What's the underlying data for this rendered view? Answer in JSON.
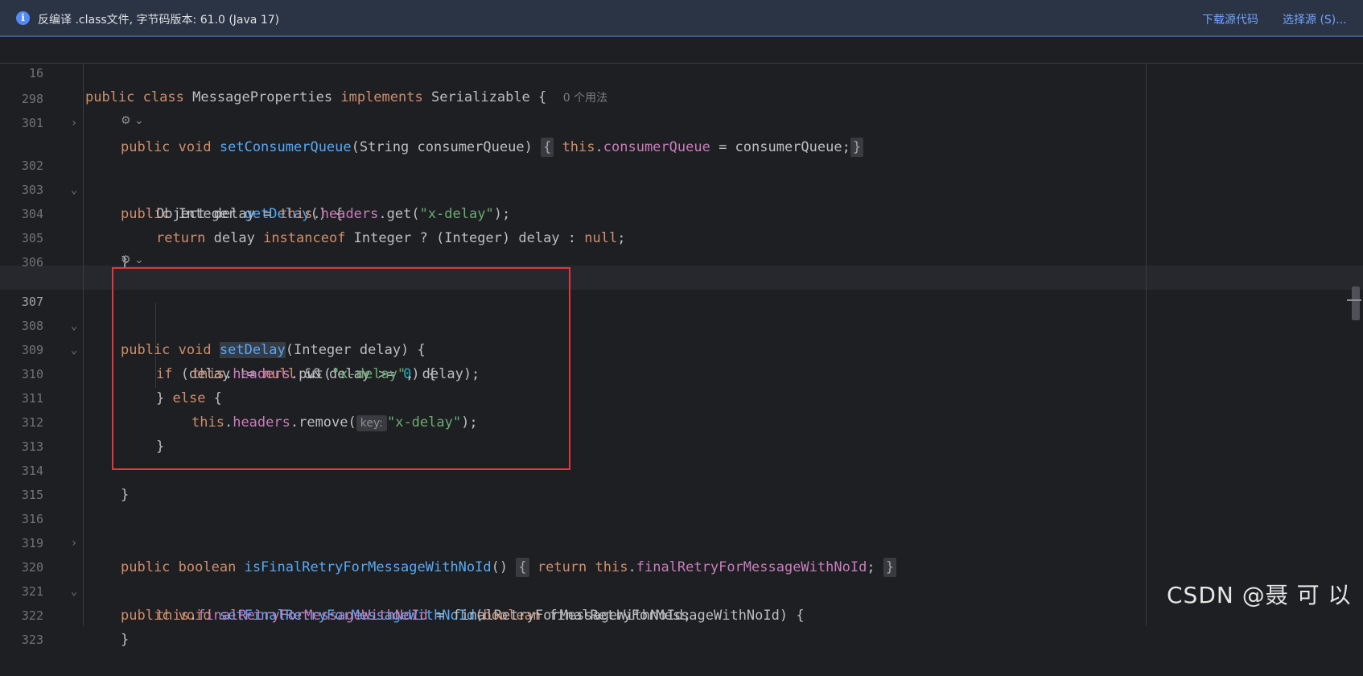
{
  "banner": {
    "message": "反编译 .class文件, 字节码版本: 61.0 (Java 17)",
    "download_link": "下载源代码",
    "choose_source_link": "选择源 (S)..."
  },
  "sticky": {
    "line_number": "16",
    "code_kw1": "public",
    "code_kw2": "class",
    "code_name": "MessageProperties",
    "code_kw3": "implements",
    "code_iface": "Serializable",
    "code_brace": "{",
    "usage_hint": "0 个用法"
  },
  "lines": {
    "l298": {
      "num": "298",
      "kw1": "public",
      "kw2": "void",
      "fn": "setConsumerQueue",
      "params": "(String consumerQueue)",
      "fold_open": "{",
      "this": "this",
      "dot": ".",
      "field": "consumerQueue",
      "rest": " = consumerQueue;",
      "fold_close": "}"
    },
    "l301": {
      "num": "301"
    },
    "l302": {
      "num": "302",
      "kw1": "public",
      "type": "Integer",
      "fn": "getDelay",
      "rest": "() {"
    },
    "l303": {
      "num": "303",
      "pre": "Object delay = ",
      "this": "this",
      "dot": ".",
      "field": "headers",
      "mid": ".get(",
      "str": "\"x-delay\"",
      "post": ");"
    },
    "l304": {
      "num": "304",
      "kw1": "return",
      "mid1": " delay ",
      "kw2": "instanceof",
      "mid2": " Integer ? (Integer) delay : ",
      "kw3": "null",
      "post": ";"
    },
    "l305": {
      "num": "305",
      "text": "}"
    },
    "l306": {
      "num": "306"
    },
    "l307": {
      "num": "307",
      "kw1": "public",
      "kw2": "void",
      "fn": "setDelay",
      "rest": "(Integer delay) {"
    },
    "l308": {
      "num": "308",
      "kw1": "if",
      "mid1": " (delay != ",
      "kw2": "null",
      "mid2": " && delay >= ",
      "num_lit": "0",
      "post": ") {"
    },
    "l309": {
      "num": "309",
      "this": "this",
      "dot": ".",
      "field": "headers",
      "mid": ".put(",
      "str": "\"x-delay\"",
      "post": ", delay);"
    },
    "l310": {
      "num": "310",
      "pre": "} ",
      "kw1": "else",
      "post": " {"
    },
    "l311": {
      "num": "311",
      "this": "this",
      "dot": ".",
      "field": "headers",
      "mid": ".remove(",
      "hint": "key:",
      "str": "\"x-delay\"",
      "post": ");"
    },
    "l312": {
      "num": "312",
      "text": "}"
    },
    "l313": {
      "num": "313"
    },
    "l314": {
      "num": "314",
      "text": "}"
    },
    "l315": {
      "num": "315"
    },
    "l316": {
      "num": "316",
      "kw1": "public",
      "kw2": "boolean",
      "fn": "isFinalRetryForMessageWithNoId",
      "params": "()",
      "fold_open": "{",
      "kw3": "return",
      "this": "this",
      "dot": ".",
      "field": "finalRetryForMessageWithNoId",
      "post": ";",
      "fold_close": "}"
    },
    "l319": {
      "num": "319"
    },
    "l320": {
      "num": "320",
      "kw1": "public",
      "kw2": "void",
      "fn": "setFinalRetryForMessageWithNoId",
      "p_open": "(",
      "kw3": "boolean",
      "rest": " finalRetryForMessageWithNoId) {"
    },
    "l321": {
      "num": "321",
      "this": "this",
      "dot": ".",
      "field": "finalRetryForMessageWithNoId",
      "post": " = finalRetryForMessageWithNoId;"
    },
    "l322": {
      "num": "322",
      "text": "}"
    },
    "l323": {
      "num": "323"
    }
  },
  "watermark": "CSDN @聂 可 以",
  "colors": {
    "background": "#1e1f22",
    "keyword": "#cf8e6d",
    "function": "#56a8f5",
    "field": "#c77dbb",
    "string": "#6aab73",
    "number": "#2aacb8",
    "highlight_box": "#e0373c",
    "link": "#6fa4ff"
  }
}
